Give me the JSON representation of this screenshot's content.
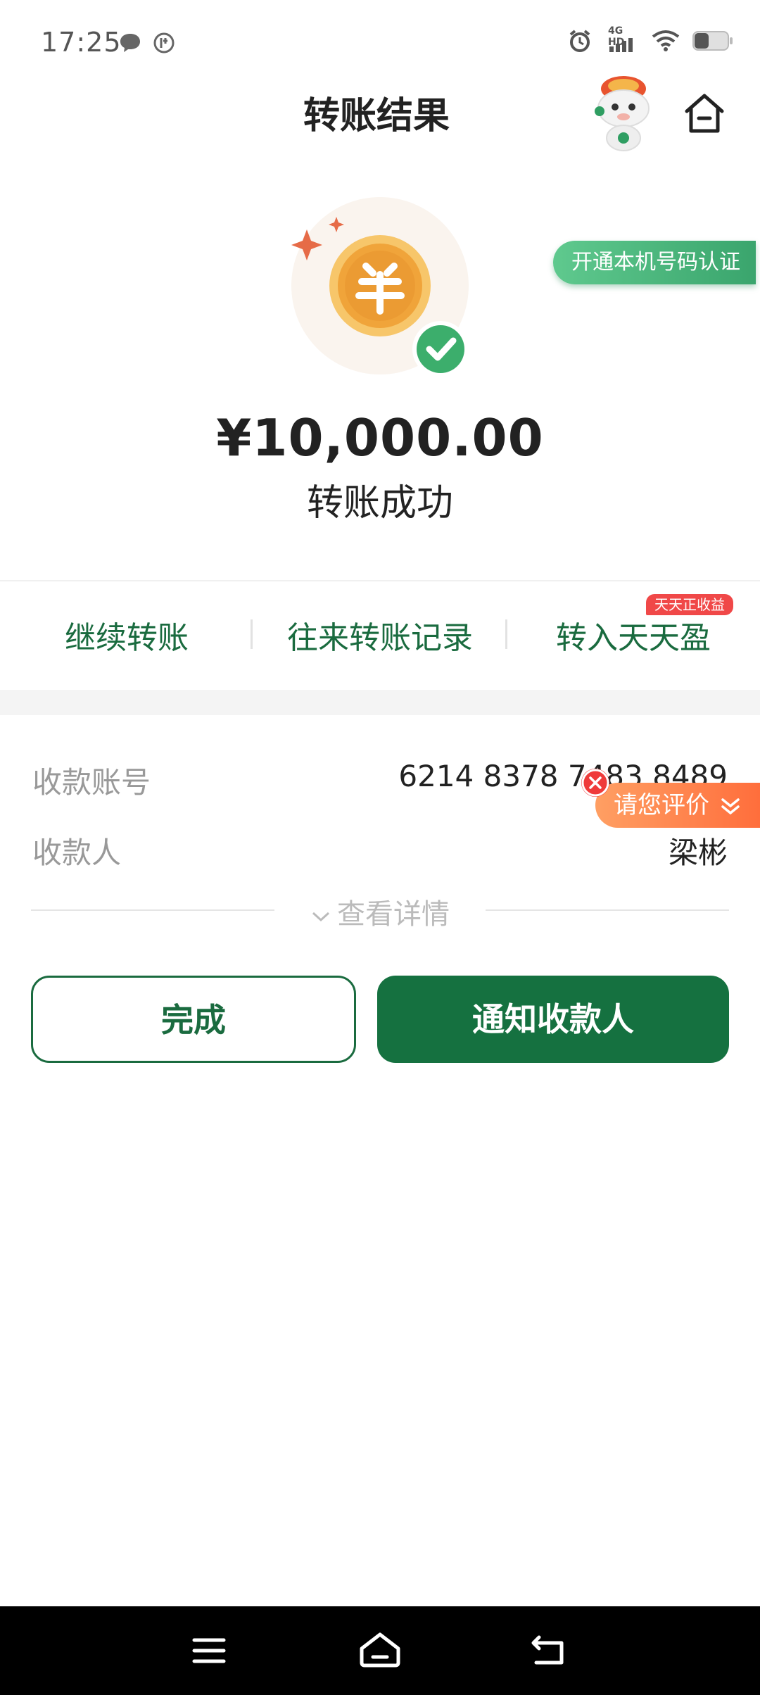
{
  "status_bar": {
    "time": "17:25",
    "network": "4G HD",
    "icons": [
      "chat-bubble-icon",
      "app-notification-icon",
      "alarm-icon",
      "signal-icon",
      "wifi-icon",
      "battery-icon"
    ]
  },
  "header": {
    "title": "转账结果",
    "home_icon": "home-icon",
    "assistant_icon": "mascot-assistant-icon"
  },
  "result": {
    "badge_label": "开通本机号码认证",
    "amount": "¥10,000.00",
    "status": "转账成功"
  },
  "actions": {
    "continue_transfer": "继续转账",
    "transfer_history": "往来转账记录",
    "deposit_tiantianying": "转入天天盈",
    "promo_tag": "天天正收益"
  },
  "details": {
    "account_label": "收款账号",
    "account_value": "6214 8378 7483 8489",
    "payee_label": "收款人",
    "payee_value": "梁彬",
    "view_details": "查看详情"
  },
  "rating": {
    "label": "请您评价"
  },
  "buttons": {
    "done": "完成",
    "notify": "通知收款人"
  },
  "colors": {
    "brand_green": "#157140",
    "success_green": "#3cae6c",
    "coin_orange": "#f0a43a",
    "promo_red": "#f04848",
    "rating_orange": "#ff7a45"
  }
}
